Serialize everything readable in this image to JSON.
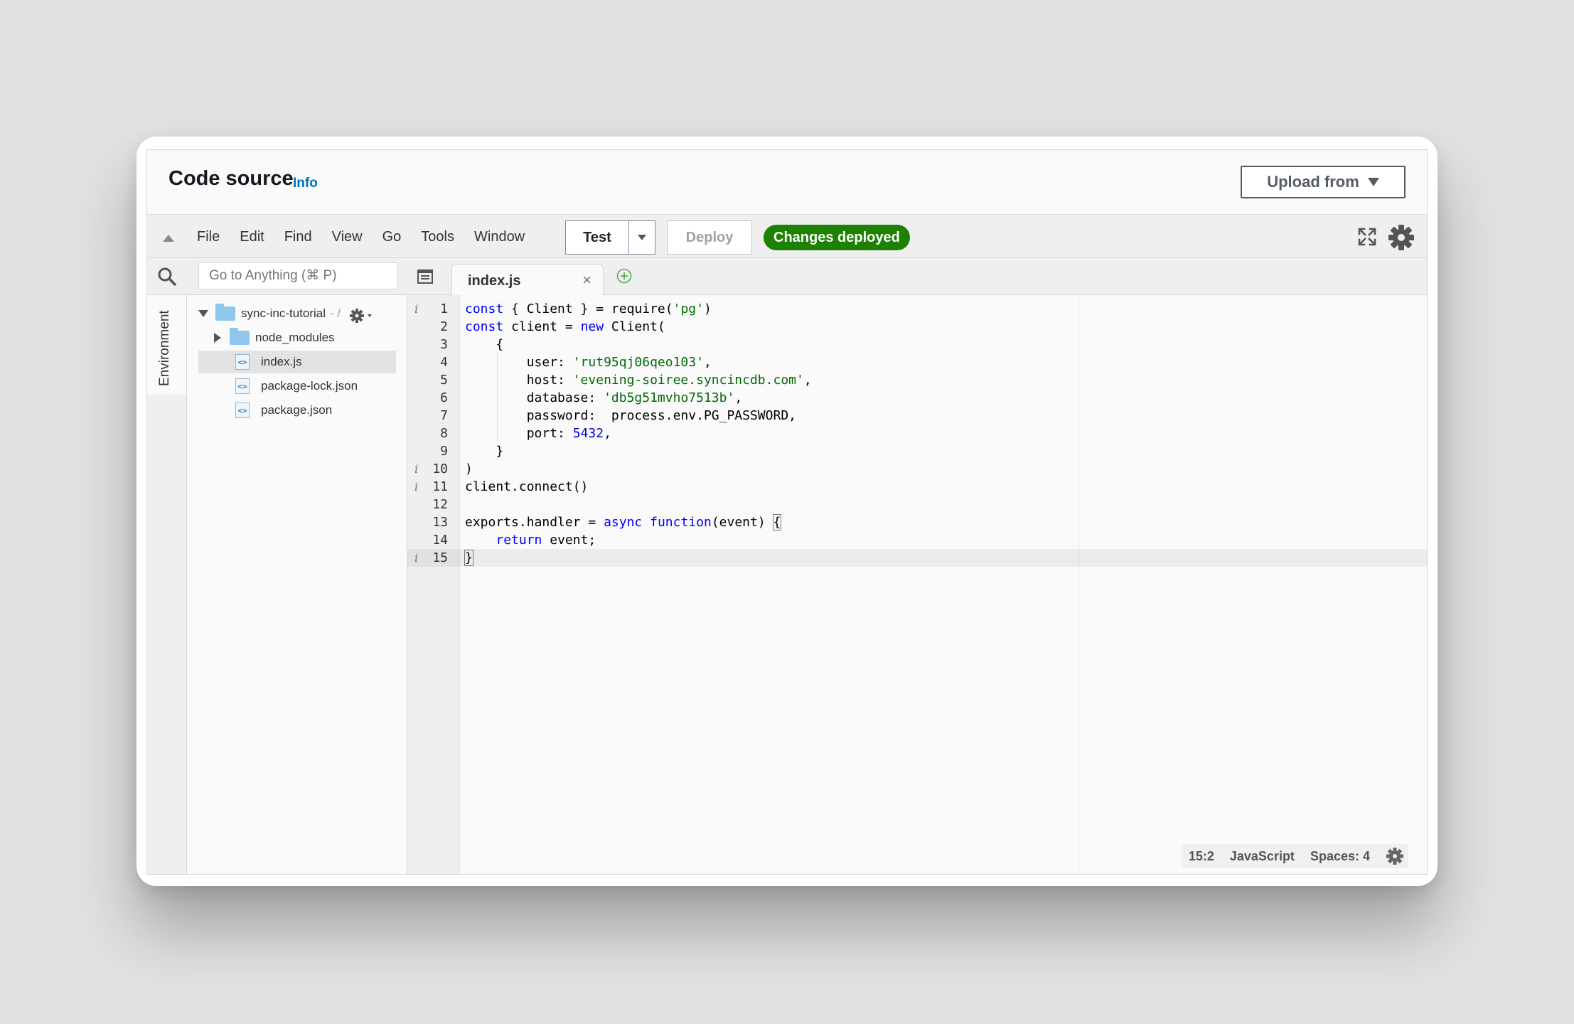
{
  "header": {
    "title": "Code source",
    "info": "Info",
    "upload_label": "Upload from"
  },
  "menu": [
    "File",
    "Edit",
    "Find",
    "View",
    "Go",
    "Tools",
    "Window"
  ],
  "toolbar": {
    "test_label": "Test",
    "deploy_label": "Deploy",
    "status_badge": "Changes deployed"
  },
  "search": {
    "placeholder": "Go to Anything (⌘ P)"
  },
  "sidebar": {
    "env_label": "Environment"
  },
  "tree": {
    "root_name": "sync-inc-tutorial",
    "root_suffix": "- /",
    "items": [
      "node_modules",
      "index.js",
      "package-lock.json",
      "package.json"
    ]
  },
  "editor": {
    "tab_name": "index.js",
    "close_glyph": "×",
    "annotation_glyph": "i",
    "line_numbers": [
      "1",
      "2",
      "3",
      "4",
      "5",
      "6",
      "7",
      "8",
      "9",
      "10",
      "11",
      "12",
      "13",
      "14",
      "15"
    ],
    "lines": [
      "const { Client } = require('pg')",
      "const client = new Client(",
      "    {",
      "        user: 'rut95qj06qeo103',",
      "        host: 'evening-soiree.syncincdb.com',",
      "        database: 'db5g51mvho7513b',",
      "        password:  process.env.PG_PASSWORD,",
      "        port: 5432,",
      "    }",
      ")",
      "client.connect()",
      "",
      "exports.handler = async function(event) {",
      "    return event;",
      "}"
    ]
  },
  "status": {
    "cursor": "15:2",
    "language": "JavaScript",
    "spaces": "Spaces: 4"
  },
  "colors": {
    "deployed_green": "#1d8102",
    "link_blue": "#0073bb",
    "keyword": "#0000ff",
    "string": "#036a07"
  }
}
